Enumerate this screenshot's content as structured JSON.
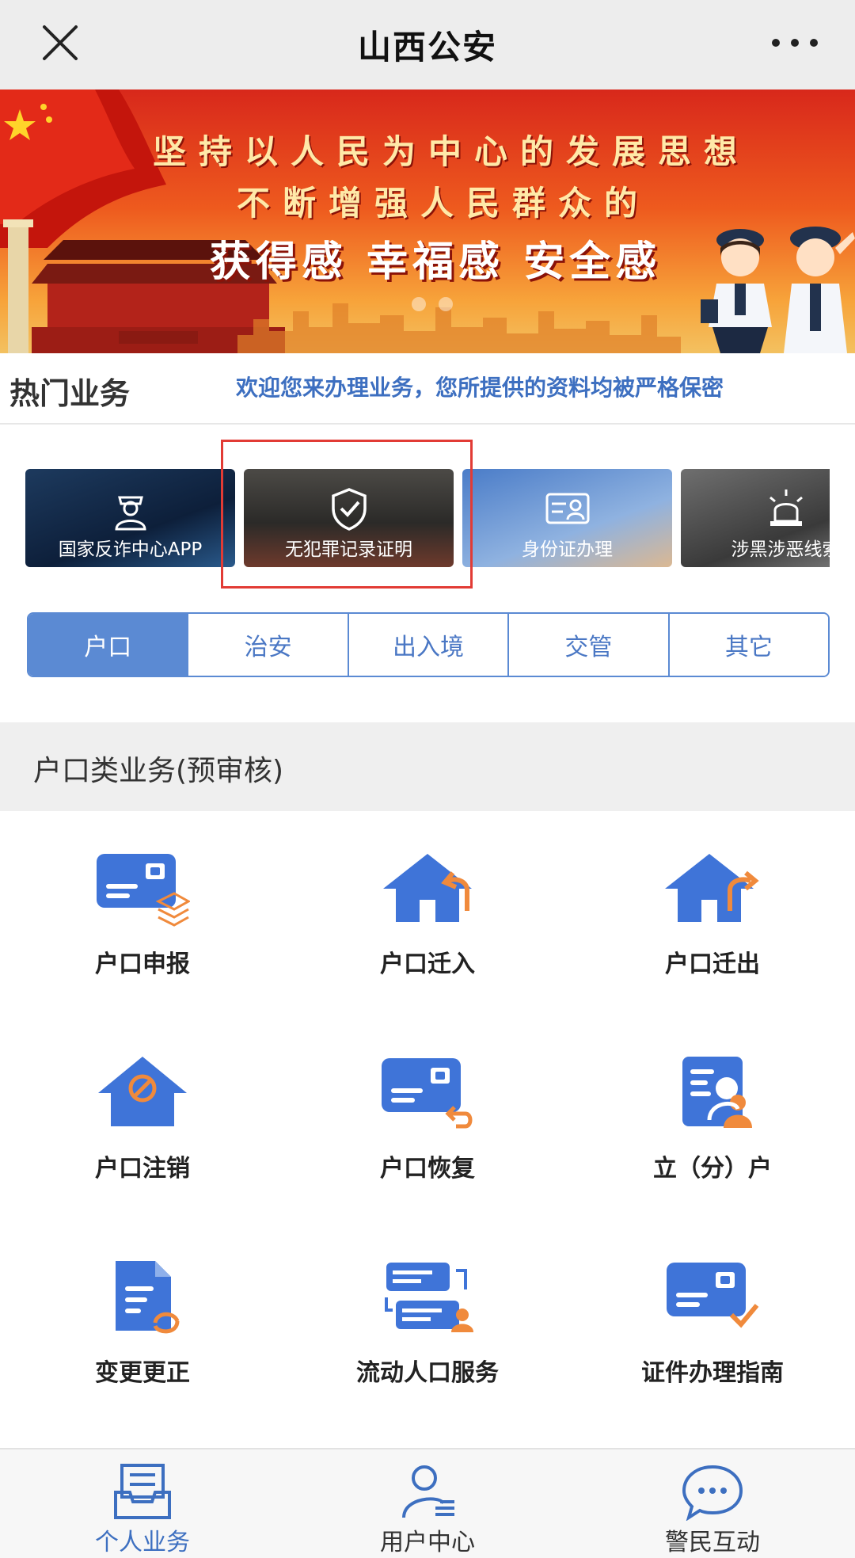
{
  "header": {
    "title": "山西公安",
    "close_icon": "close-icon",
    "more_icon": "more-icon"
  },
  "banner": {
    "line1": "坚持以人民为中心的发展思想",
    "line2": "不断增强人民群众的",
    "line3": "获得感 幸福感 安全感",
    "slide_count": 2
  },
  "hot": {
    "title": "热门业务",
    "notice": "欢迎您来办理业务，您所提供的资料均被严格保密",
    "cards": [
      {
        "label": "国家反诈中心APP",
        "icon": "police-officer-icon"
      },
      {
        "label": "无犯罪记录证明",
        "icon": "shield-check-icon"
      },
      {
        "label": "身份证办理",
        "icon": "id-card-icon"
      },
      {
        "label": "涉黑涉恶线索",
        "icon": "alarm-light-icon"
      }
    ],
    "highlighted_card": "无犯罪记录证明"
  },
  "tabs": [
    {
      "label": "户口",
      "active": true
    },
    {
      "label": "治安",
      "active": false
    },
    {
      "label": "出入境",
      "active": false
    },
    {
      "label": "交管",
      "active": false
    },
    {
      "label": "其它",
      "active": false
    }
  ],
  "section": {
    "title": "户口类业务(预审核)"
  },
  "services": [
    {
      "label": "户口申报",
      "icon": "card-layers-icon"
    },
    {
      "label": "户口迁入",
      "icon": "house-in-icon"
    },
    {
      "label": "户口迁出",
      "icon": "house-out-icon"
    },
    {
      "label": "户口注销",
      "icon": "house-cancel-icon"
    },
    {
      "label": "户口恢复",
      "icon": "card-restore-icon"
    },
    {
      "label": "立（分）户",
      "icon": "profile-card-icon"
    },
    {
      "label": "变更更正",
      "icon": "document-refresh-icon"
    },
    {
      "label": "流动人口服务",
      "icon": "transfer-cards-icon"
    },
    {
      "label": "证件办理指南",
      "icon": "card-check-icon"
    }
  ],
  "bottom_nav": [
    {
      "label": "个人业务",
      "icon": "inbox-tray-icon",
      "active": true
    },
    {
      "label": "用户中心",
      "icon": "user-list-icon",
      "active": false
    },
    {
      "label": "警民互动",
      "icon": "chat-bubble-icon",
      "active": false
    }
  ],
  "colors": {
    "accent": "#5b8ad3",
    "icon_blue": "#3f74d8",
    "icon_orange": "#f08a3c",
    "highlight_red": "#e23b35"
  }
}
